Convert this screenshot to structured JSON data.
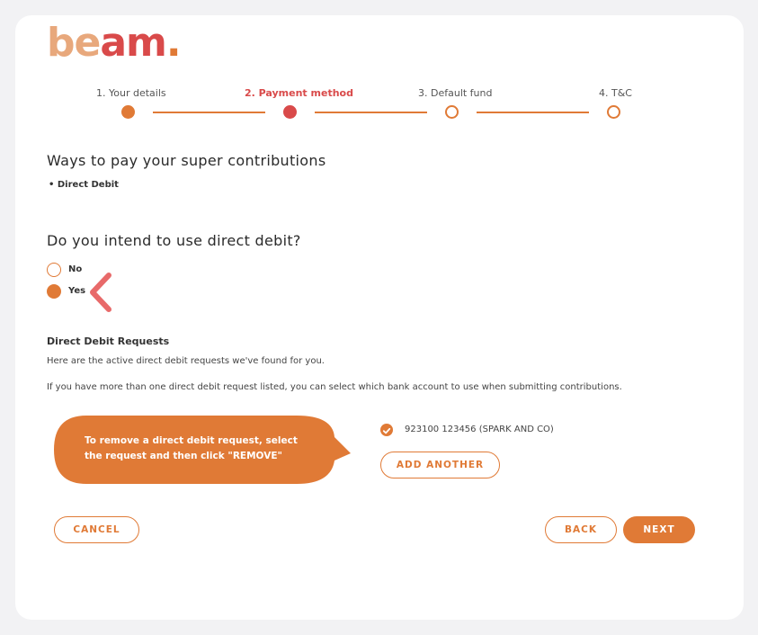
{
  "brand": {
    "logo_part1": "be",
    "logo_part2": "am",
    "logo_dot": "."
  },
  "steps": [
    {
      "label": "1. Your details",
      "state": "done"
    },
    {
      "label": "2. Payment method",
      "state": "current"
    },
    {
      "label": "3. Default fund",
      "state": "todo"
    },
    {
      "label": "4. T&C",
      "state": "todo"
    }
  ],
  "payment_ways": {
    "heading": "Ways to pay your super contributions",
    "bullet": "• Direct Debit"
  },
  "direct_debit_question": {
    "heading": "Do you intend to use direct debit?",
    "options": [
      {
        "label": "No",
        "selected": false
      },
      {
        "label": "Yes",
        "selected": true
      }
    ]
  },
  "dd_requests": {
    "title": "Direct Debit Requests",
    "desc1": "Here are the active direct debit requests we've found for you.",
    "desc2": "If you have more than one direct debit request listed, you can select which bank account to use when submitting contributions.",
    "accounts": [
      {
        "label": "923100 123456 (SPARK AND CO)",
        "checked": true
      }
    ],
    "add_another_label": "ADD ANOTHER"
  },
  "callout": {
    "line1": "To remove a direct debit request, select",
    "line2": "the request and then click \"REMOVE\""
  },
  "footer": {
    "cancel_label": "CANCEL",
    "back_label": "BACK",
    "next_label": "NEXT"
  },
  "colors": {
    "accent": "#e07a36",
    "active_step": "#d94a4a",
    "annotation": "#e86a6a"
  }
}
